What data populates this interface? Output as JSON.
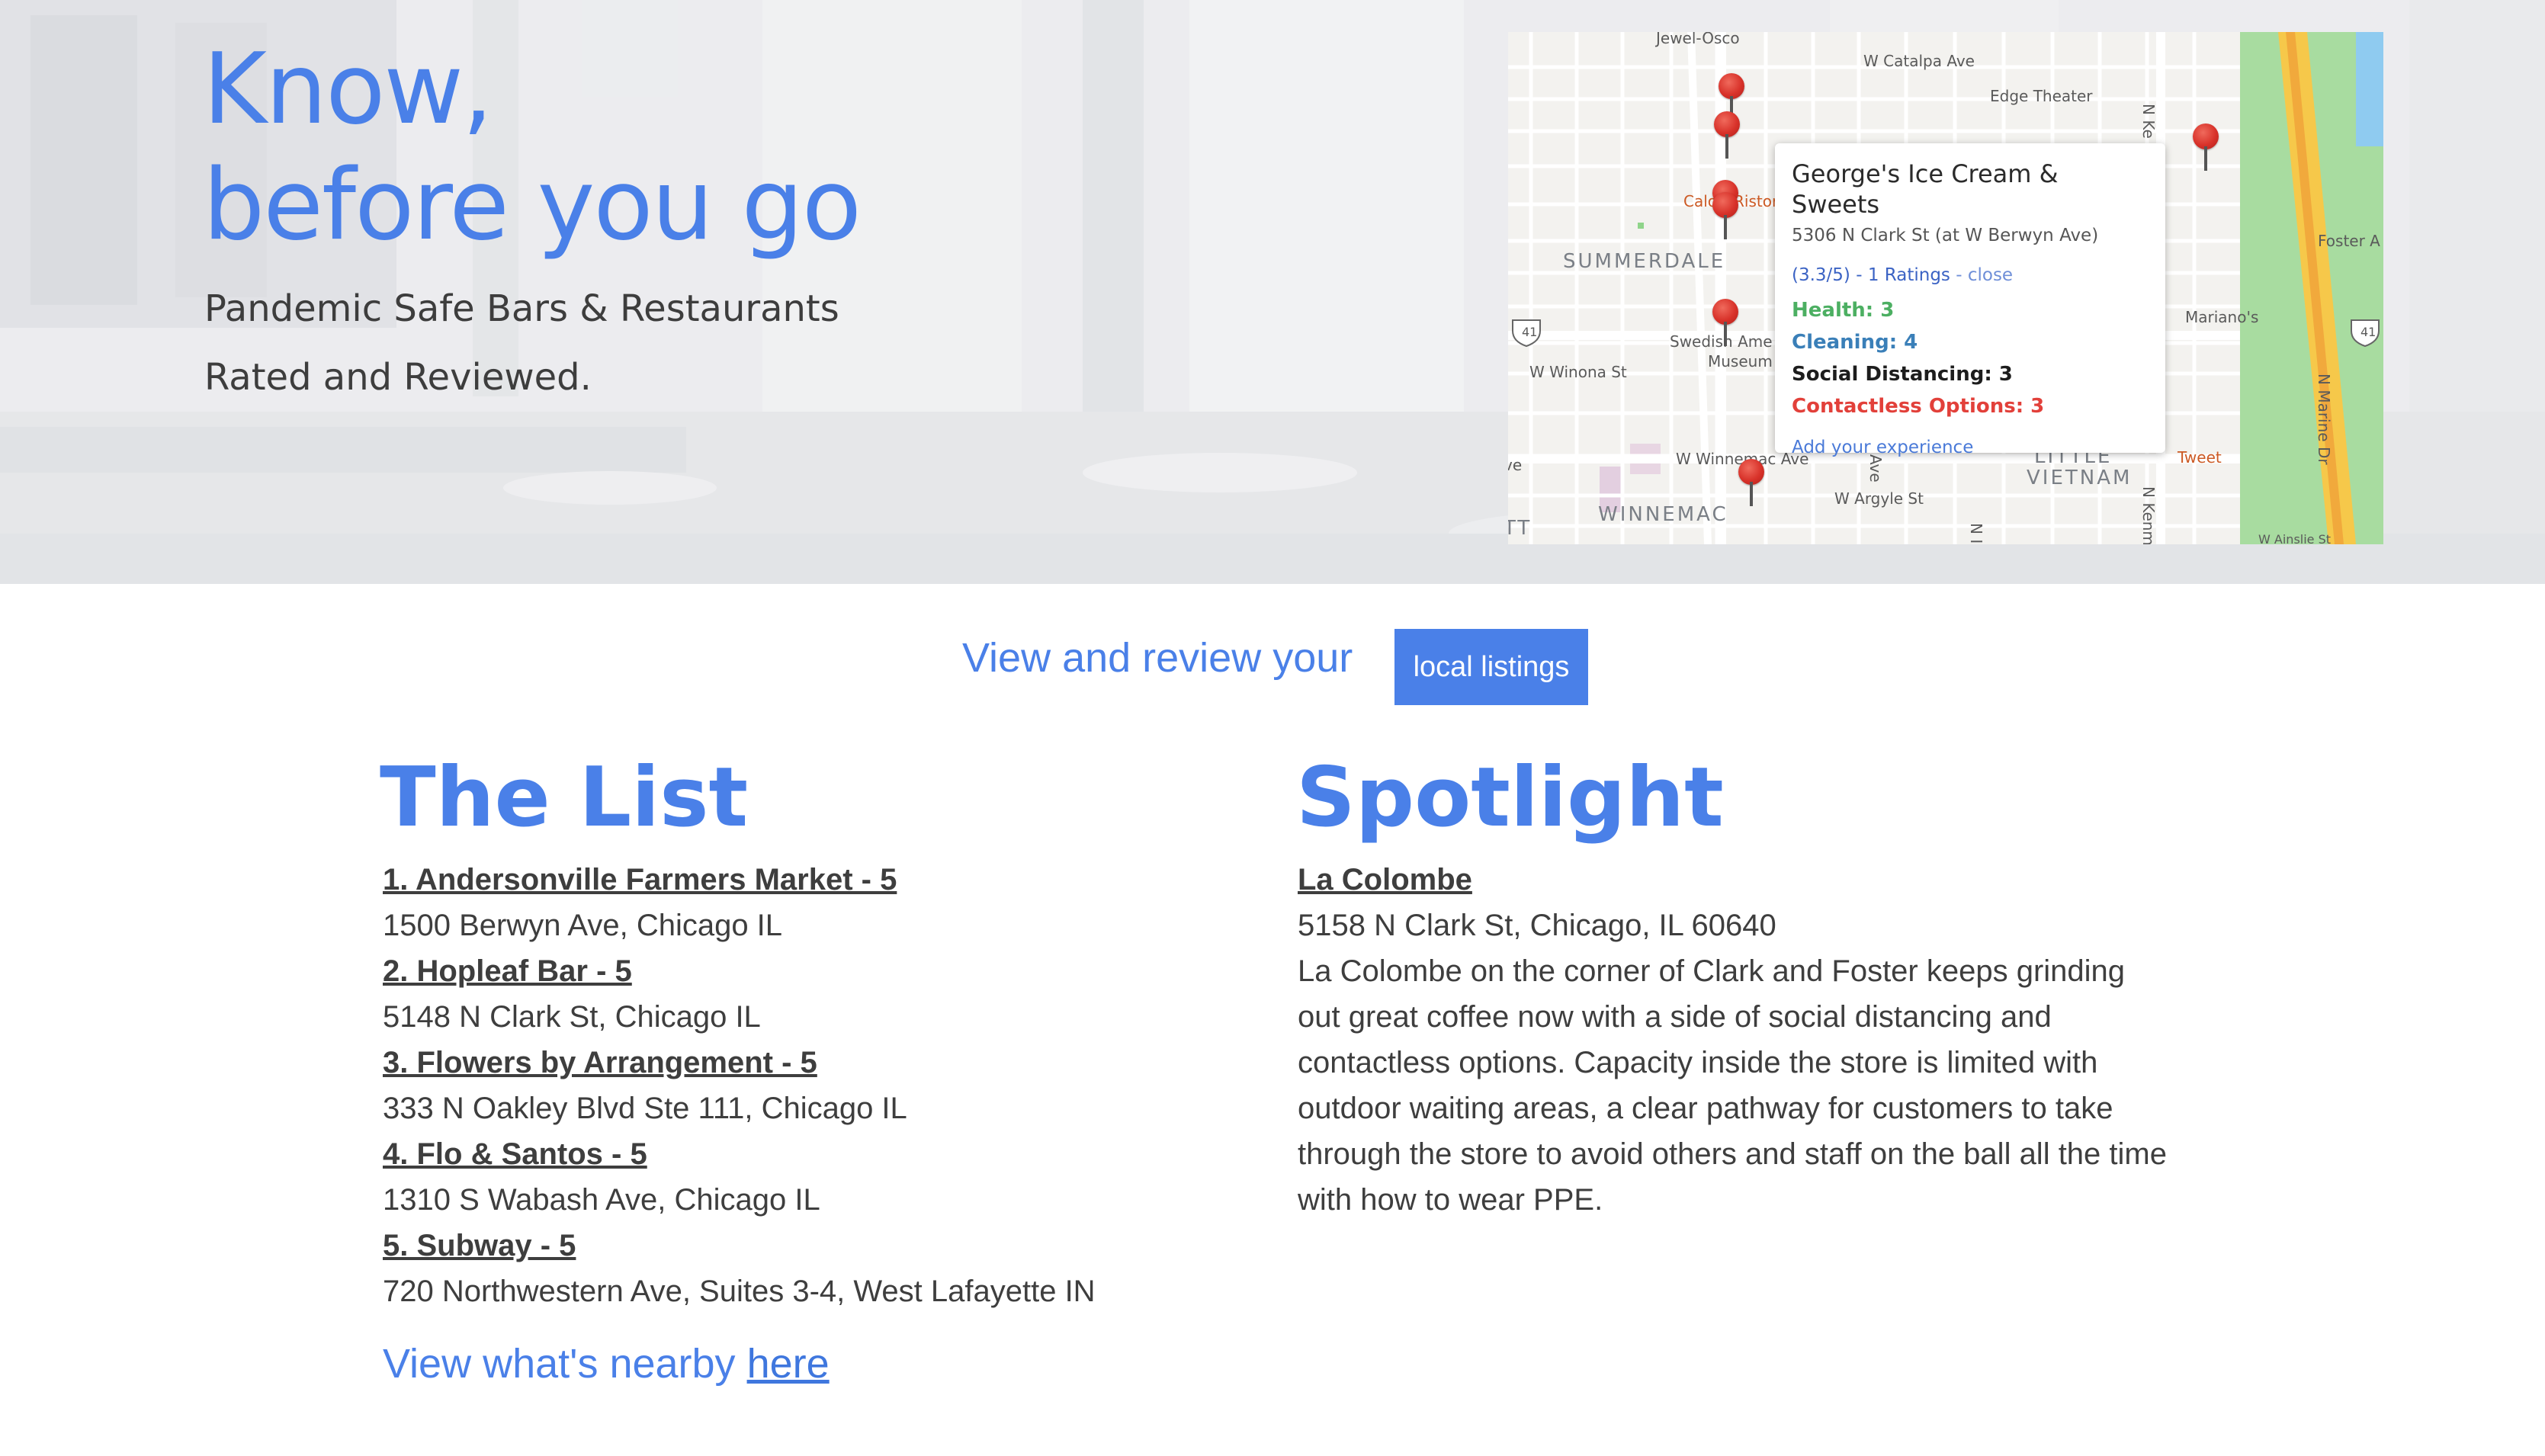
{
  "hero": {
    "title_line1": "Know,",
    "title_line2": "before you go",
    "subtitle_line1": "Pandemic Safe Bars & Restaurants",
    "subtitle_line2": "Rated and Reviewed."
  },
  "map": {
    "labels": {
      "jewel_osco": "Jewel-Osco",
      "catalpa": "W Catalpa Ave",
      "edge_theater": "Edge Theater",
      "summerdale": "SUMMERDALE",
      "calo": "Calo",
      "ristor": "Ristor",
      "swedish_museum_1": "Swedish Ame",
      "swedish_museum_2": "Museum",
      "winona": "W Winona St",
      "winnemac_ave": "W Winnemac Ave",
      "argyle": "W Argyle St",
      "winnemac_area": "WINNEMAC",
      "little_vietnam_1": "LITTLE",
      "little_vietnam_2": "VIETNAM",
      "marianos": "Mariano's",
      "tweet": "Tweet",
      "foster": "Foster A",
      "marine_dr": "N Marine Dr",
      "n_kenmore": "N Kenm",
      "n_ke": "N Ke",
      "route_41": "41",
      "ve": "ve",
      "ave": "Ave",
      "ott": "TT",
      "ainslie": "W Ainslie St",
      "ni": "N I"
    },
    "info_window": {
      "name": "George's Ice Cream & Sweets",
      "address": "5306 N Clark St (at W Berwyn Ave)",
      "rating": "(3.3/5) - 1 Ratings",
      "rating_sep": " - ",
      "close": "close",
      "health": "Health: 3",
      "cleaning": "Cleaning: 4",
      "social": "Social Distancing: 3",
      "contactless": "Contactless Options: 3",
      "add_experience": "Add your experience"
    }
  },
  "cta": {
    "text": "View and review your",
    "button": "local listings"
  },
  "list": {
    "title": "The List",
    "items": [
      {
        "name": "1. Andersonville Farmers Market - 5",
        "address": "1500 Berwyn Ave, Chicago IL"
      },
      {
        "name": "2. Hopleaf Bar - 5",
        "address": "5148 N Clark St, Chicago IL"
      },
      {
        "name": "3. Flowers by Arrangement - 5",
        "address": "333 N Oakley Blvd Ste 111, Chicago IL"
      },
      {
        "name": "4. Flo & Santos - 5",
        "address": "1310 S Wabash Ave, Chicago IL"
      },
      {
        "name": "5. Subway - 5",
        "address": "720 Northwestern Ave, Suites 3-4, West Lafayette IN"
      }
    ],
    "nearby_text": "View what's nearby ",
    "nearby_link": "here"
  },
  "spotlight": {
    "title": "Spotlight",
    "name": "La Colombe",
    "address": "5158 N Clark St, Chicago, IL 60640",
    "description": "La Colombe on the corner of Clark and Foster keeps grinding out great coffee now with a side of social distancing and contactless options. Capacity inside the store is limited with outdoor waiting areas, a clear pathway for customers to take through the store to avoid others and staff on the ball all the time with how to wear PPE."
  },
  "colors": {
    "accent": "#4a80e8",
    "health": "#4caf62",
    "cleaning": "#3a7fb8",
    "contactless": "#e2403a",
    "pin": "#d8322a"
  }
}
